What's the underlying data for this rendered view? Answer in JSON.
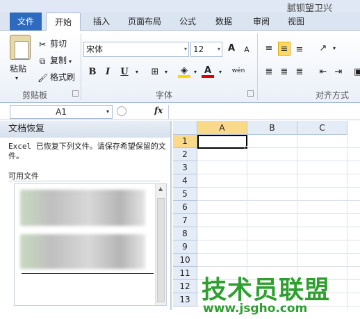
{
  "window": {
    "title_fragment": "腻钡望卫兴"
  },
  "tabs": [
    {
      "label": "文件"
    },
    {
      "label": "开始"
    },
    {
      "label": "插入"
    },
    {
      "label": "页面布局"
    },
    {
      "label": "公式"
    },
    {
      "label": "数据"
    },
    {
      "label": "审阅"
    },
    {
      "label": "视图"
    }
  ],
  "clipboard": {
    "paste": "粘贴",
    "cut": "剪切",
    "copy": "复制",
    "format_painter": "格式刷",
    "group_label": "剪贴板"
  },
  "font": {
    "name": "宋体",
    "size": "12",
    "grow": "A",
    "shrink": "A",
    "bold": "B",
    "italic": "I",
    "underline": "U",
    "font_color_letter": "A",
    "phonetic": "wén",
    "group_label": "字体"
  },
  "alignment": {
    "group_label": "对齐方式"
  },
  "formula_bar": {
    "name_box": "A1",
    "fx": "fx",
    "value": ""
  },
  "recovery": {
    "title": "文档恢复",
    "message": "Excel 已恢复下列文件。请保存希望保留的文件。",
    "available_files": "可用文件"
  },
  "sheet": {
    "columns": [
      "A",
      "B",
      "C"
    ],
    "rows": [
      "1",
      "2",
      "3",
      "4",
      "5",
      "6",
      "7",
      "8",
      "9",
      "10",
      "11",
      "12",
      "13"
    ],
    "active_cell": "A1"
  },
  "watermark": {
    "text": "技术员联盟",
    "url": "www.jsgho.com"
  },
  "colors": {
    "file_tab": "#2e6bbf",
    "selection": "#f9d98a",
    "watermark": "#2fa02f"
  }
}
